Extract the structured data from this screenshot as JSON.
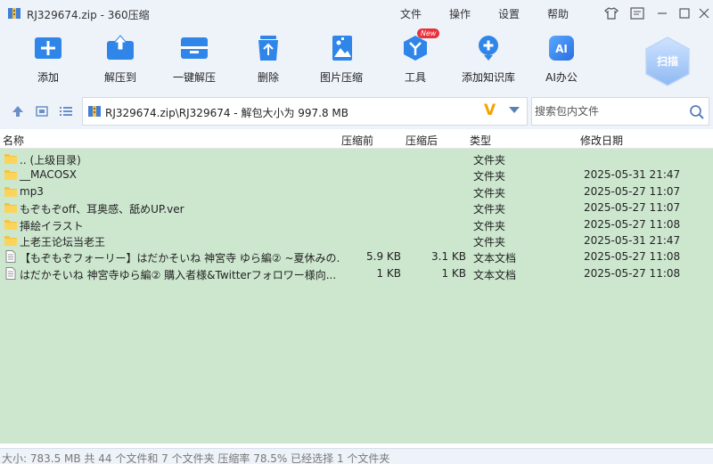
{
  "window": {
    "title": "RJ329674.zip - 360压缩"
  },
  "menu": [
    "文件",
    "操作",
    "设置",
    "帮助"
  ],
  "toolbar": {
    "items": [
      {
        "label": "添加",
        "icon": "add-archive-icon"
      },
      {
        "label": "解压到",
        "icon": "extract-to-icon"
      },
      {
        "label": "一键解压",
        "icon": "one-click-extract-icon"
      },
      {
        "label": "删除",
        "icon": "delete-icon"
      },
      {
        "label": "图片压缩",
        "icon": "image-compress-icon"
      },
      {
        "label": "工具",
        "icon": "tools-icon",
        "badge": "New"
      },
      {
        "label": "添加知识库",
        "icon": "knowledge-base-icon"
      },
      {
        "label": "AI办公",
        "icon": "ai-office-icon"
      }
    ],
    "scan_label": "扫描"
  },
  "address": {
    "path": "RJ329674.zip\\RJ329674 - 解包大小为 997.8 MB"
  },
  "search": {
    "placeholder": "搜索包内文件"
  },
  "columns": {
    "name": "名称",
    "compressed": "压缩前",
    "original": "压缩后",
    "type": "类型",
    "date": "修改日期"
  },
  "files": [
    {
      "name": ".. (上级目录)",
      "compressed": "",
      "original": "",
      "type": "文件夹",
      "date": "",
      "kind": "folder"
    },
    {
      "name": "__MACOSX",
      "compressed": "",
      "original": "",
      "type": "文件夹",
      "date": "2025-05-31 21:47",
      "kind": "folder"
    },
    {
      "name": "mp3",
      "compressed": "",
      "original": "",
      "type": "文件夹",
      "date": "2025-05-27 11:07",
      "kind": "folder"
    },
    {
      "name": "もぞもぞoff、耳奥感、舐めUP.ver",
      "compressed": "",
      "original": "",
      "type": "文件夹",
      "date": "2025-05-27 11:07",
      "kind": "folder"
    },
    {
      "name": "挿絵イラスト",
      "compressed": "",
      "original": "",
      "type": "文件夹",
      "date": "2025-05-27 11:08",
      "kind": "folder"
    },
    {
      "name": "上老王论坛当老王",
      "compressed": "",
      "original": "",
      "type": "文件夹",
      "date": "2025-05-31 21:47",
      "kind": "folder"
    },
    {
      "name": "【もぞもぞフォーリー】はだかそいね 神宮寺 ゆら編② ~夏休みの...",
      "compressed": "5.9 KB",
      "original": "3.1 KB",
      "type": "文本文档",
      "date": "2025-05-27 11:08",
      "kind": "text"
    },
    {
      "name": "はだかそいね 神宮寺ゆら編② 購入者様&Twitterフォロワー様向...",
      "compressed": "1 KB",
      "original": "1 KB",
      "type": "文本文档",
      "date": "2025-05-27 11:08",
      "kind": "text"
    }
  ],
  "status": {
    "text": "大小: 783.5 MB 共 44 个文件和 7 个文件夹 压缩率 78.5% 已经选择 1 个文件夹"
  }
}
